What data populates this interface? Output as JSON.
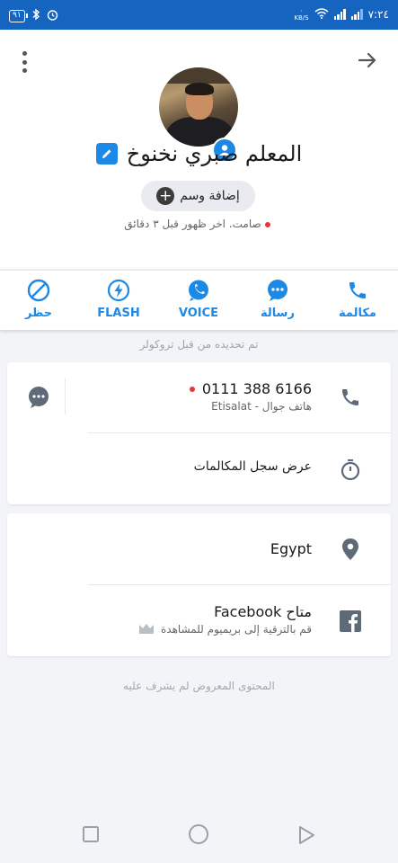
{
  "status_bar": {
    "battery": "٩١",
    "speed_value": "٠",
    "speed_unit": "KB/S",
    "time": "٧:٢٤"
  },
  "icons": {
    "menu": "more-vert-icon",
    "forward": "arrow-forward-icon",
    "edit": "edit-icon",
    "contact_badge": "account-circle-icon",
    "call": "phone-icon",
    "message": "chat-bubble-icon",
    "voice": "whatsapp-icon",
    "flash": "flash-icon",
    "block": "block-icon",
    "timer": "timer-icon",
    "location": "location-pin-icon",
    "facebook": "facebook-icon",
    "crown": "crown-icon"
  },
  "profile": {
    "name": "المعلم صبري نخنوخ",
    "tag_label": "إضافة وسم",
    "status": "صامت. اخر ظهور قبل ٣ دقائق"
  },
  "actions": [
    {
      "id": "call",
      "label": "مكالمة"
    },
    {
      "id": "message",
      "label": "رسالة"
    },
    {
      "id": "voice",
      "label": "VOICE"
    },
    {
      "id": "flash",
      "label": "FLASH"
    },
    {
      "id": "block",
      "label": "حظر"
    }
  ],
  "caption": "تم تحديده من قبل تروكولر",
  "phone": {
    "number": "0111 388 6166",
    "subtitle": "هاتف جوال - Etisalat"
  },
  "call_history": {
    "label": "عرض سجل المكالمات"
  },
  "location": {
    "country": "Egypt"
  },
  "facebook": {
    "title": "Facebook متاح",
    "subtitle": "قم بالترقية إلى بريميوم للمشاهدة"
  },
  "footer_note": "المحتوى المعروض لم يشرف عليه",
  "colors": {
    "accent": "#1e88e5",
    "status_bar": "#1565c0",
    "icon_gray": "#5f6a78",
    "online_dot": "#e53935",
    "background": "#f3f4f8"
  },
  "nav_buttons": [
    "recent-apps",
    "home",
    "back"
  ]
}
